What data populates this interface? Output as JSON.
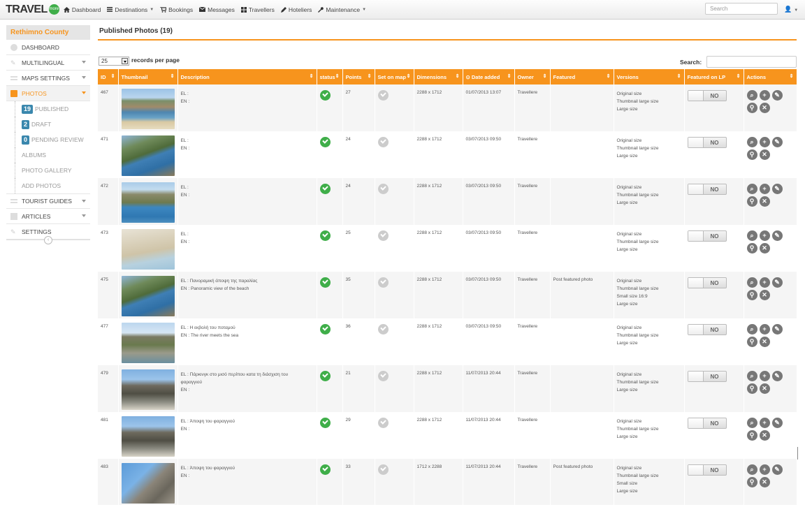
{
  "navbar": {
    "brand": "TRAVEL",
    "brand_badge": "more",
    "items": [
      {
        "label": "Dashboard",
        "dropdown": false
      },
      {
        "label": "Destinations",
        "dropdown": true
      },
      {
        "label": "Bookings",
        "dropdown": false
      },
      {
        "label": "Messages",
        "dropdown": false
      },
      {
        "label": "Travellers",
        "dropdown": false
      },
      {
        "label": "Hoteliers",
        "dropdown": false
      },
      {
        "label": "Maintenance",
        "dropdown": true
      }
    ],
    "search_placeholder": "Search"
  },
  "sidebar": {
    "title": "Rethimno County",
    "items": {
      "dashboard": "DASHBOARD",
      "multilingual": "MULTILINGUAL",
      "maps_settings": "MAPS SETTINGS",
      "photos": "PHOTOS",
      "published_count": "19",
      "published": "PUBLISHED",
      "draft_count": "2",
      "draft": "DRAFT",
      "pending_count": "0",
      "pending": "PENDING REVIEW",
      "albums": "ALBUMS",
      "gallery": "PHOTO GALLERY",
      "add_photos": "ADD PHOTOS",
      "tourist_guides": "TOURIST GUIDES",
      "articles": "ARTICLES",
      "settings": "SETTINGS"
    },
    "collapse_icon": "chevron-left-icon"
  },
  "main": {
    "title": "Published Photos (19)",
    "page_size": "25",
    "page_size_label": "records per page",
    "search_label": "Search:",
    "columns": [
      "ID",
      "Thumbnail",
      "Description",
      "status",
      "Points",
      "Set on map",
      "Dimensions",
      "Date added",
      "Owner",
      "Featured",
      "Versions",
      "Featured on LP",
      "Actions"
    ],
    "toggle_label": "NO",
    "rows": [
      {
        "id": "467",
        "desc": [
          "EL :",
          "EN :"
        ],
        "points": "27",
        "dims": "2288 x 1712",
        "date": "01/07/2013 13:07",
        "owner": "Travellere",
        "featured": "",
        "versions": [
          "Original size",
          "Thumbnail large size",
          "Large size"
        ],
        "thumb": "beach-bay"
      },
      {
        "id": "471",
        "desc": [
          "EL :",
          "EN :"
        ],
        "points": "24",
        "dims": "2288 x 1712",
        "date": "03/07/2013 09:50",
        "owner": "Travellere",
        "featured": "",
        "versions": [
          "Original size",
          "Thumbnail large size",
          "Large size"
        ],
        "thumb": "gorge-coast"
      },
      {
        "id": "472",
        "desc": [
          "EL :",
          "EN :"
        ],
        "points": "24",
        "dims": "2288 x 1712",
        "date": "03/07/2013 09:50",
        "owner": "Travellere",
        "featured": "",
        "versions": [
          "Original size",
          "Thumbnail large size",
          "Large size"
        ],
        "thumb": "cliff-sea"
      },
      {
        "id": "473",
        "desc": [
          "EL :",
          "EN :"
        ],
        "points": "25",
        "dims": "2288 x 1712",
        "date": "03/07/2013 09:50",
        "owner": "Travellere",
        "featured": "",
        "versions": [
          "Original size",
          "Thumbnail large size",
          "Large size"
        ],
        "thumb": "crowded-beach"
      },
      {
        "id": "475",
        "desc": [
          "EL : Πανοραμική άποψη της παραλίας",
          "EN : Panoramic view of the beach"
        ],
        "points": "35",
        "dims": "2288 x 1712",
        "date": "03/07/2013 09:50",
        "owner": "Travellere",
        "featured": "Post featured photo",
        "versions": [
          "Original size",
          "Thumbnail large size",
          "Small size 16:9",
          "Large size"
        ],
        "thumb": "gorge-coast"
      },
      {
        "id": "477",
        "desc": [
          "EL : Η εκβολή του ποταμού",
          "EN : The river meets the sea"
        ],
        "points": "36",
        "dims": "2288 x 1712",
        "date": "03/07/2013 09:50",
        "owner": "Travellere",
        "featured": "",
        "versions": [
          "Original size",
          "Thumbnail large size",
          "Large size"
        ],
        "thumb": "river-mouth"
      },
      {
        "id": "479",
        "desc": [
          "EL : Πάρκινγκ στο μισό περίπου κατα τη διάσχιση του",
          "φαραγγιού",
          "EN :"
        ],
        "points": "21",
        "dims": "2288 x 1712",
        "date": "11/07/2013 20:44",
        "owner": "Travellere",
        "featured": "",
        "versions": [
          "Original size",
          "Thumbnail large size",
          "Large size"
        ],
        "thumb": "canyon"
      },
      {
        "id": "481",
        "desc": [
          "EL : Άποψη του φαραγγιού",
          "EN :"
        ],
        "points": "29",
        "dims": "2288 x 1712",
        "date": "11/07/2013 20:44",
        "owner": "Travellere",
        "featured": "",
        "versions": [
          "Original size",
          "Thumbnail large size",
          "Large size"
        ],
        "thumb": "canyon"
      },
      {
        "id": "483",
        "desc": [
          "EL : Άποψη του φαραγγιού",
          "EN :"
        ],
        "points": "33",
        "dims": "1712 x 2288",
        "date": "11/07/2013 20:44",
        "owner": "Travellere",
        "featured": "Post featured photo",
        "versions": [
          "Original size",
          "Thumbnail large size",
          "Small size",
          "Large size"
        ],
        "thumb": "cliff-sky"
      }
    ],
    "action_icons": [
      "magnifier-icon",
      "plus-icon",
      "edit-icon",
      "map-pin-icon",
      "close-icon"
    ]
  },
  "colors": {
    "accent": "#f7941d",
    "success": "#3fae49",
    "badge": "#3a87ad"
  }
}
